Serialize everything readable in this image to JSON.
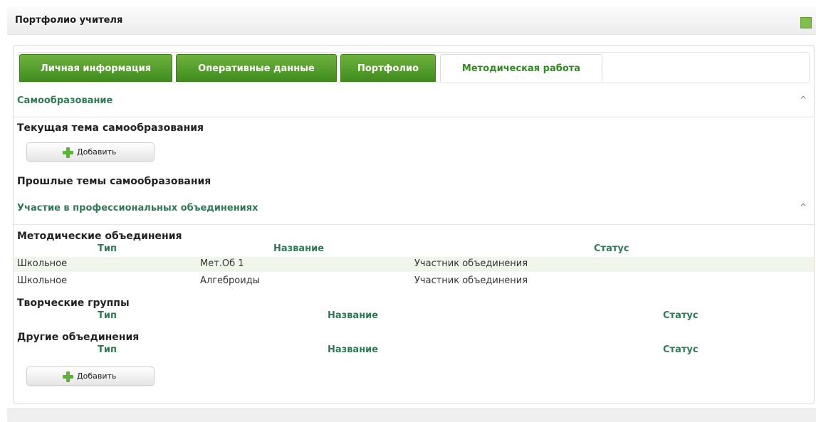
{
  "header": {
    "title": "Портфолио учителя"
  },
  "tabs": [
    {
      "label": "Личная информация",
      "active": false
    },
    {
      "label": "Оперативные данные",
      "active": false
    },
    {
      "label": "Портфолио",
      "active": false
    },
    {
      "label": "Методическая работа",
      "active": true
    }
  ],
  "self_education": {
    "title": "Самообразование",
    "current_topic": "Текущая тема самообразования",
    "add_label": "Добавить",
    "past_topics": "Прошлые темы самообразования"
  },
  "professional": {
    "title": "Участие в профессиональных объединениях",
    "methodical": {
      "title": "Методические объединения",
      "columns": [
        "Тип",
        "Название",
        "Статус"
      ],
      "rows": [
        [
          "Школьное",
          "Мет.Об 1",
          "Участник объединения"
        ],
        [
          "Школьное",
          "Алгеброиды",
          "Участник объединения"
        ]
      ]
    },
    "creative": {
      "title": "Творческие группы",
      "columns": [
        "Тип",
        "Название",
        "Статус"
      ]
    },
    "other": {
      "title": "Другие объединения",
      "columns": [
        "Тип",
        "Название",
        "Статус"
      ]
    },
    "add_label": "Добавить"
  },
  "colors": {
    "accent": "#3f8c1d",
    "link": "#2f7a55",
    "row_alt": "#f1f6ec"
  }
}
